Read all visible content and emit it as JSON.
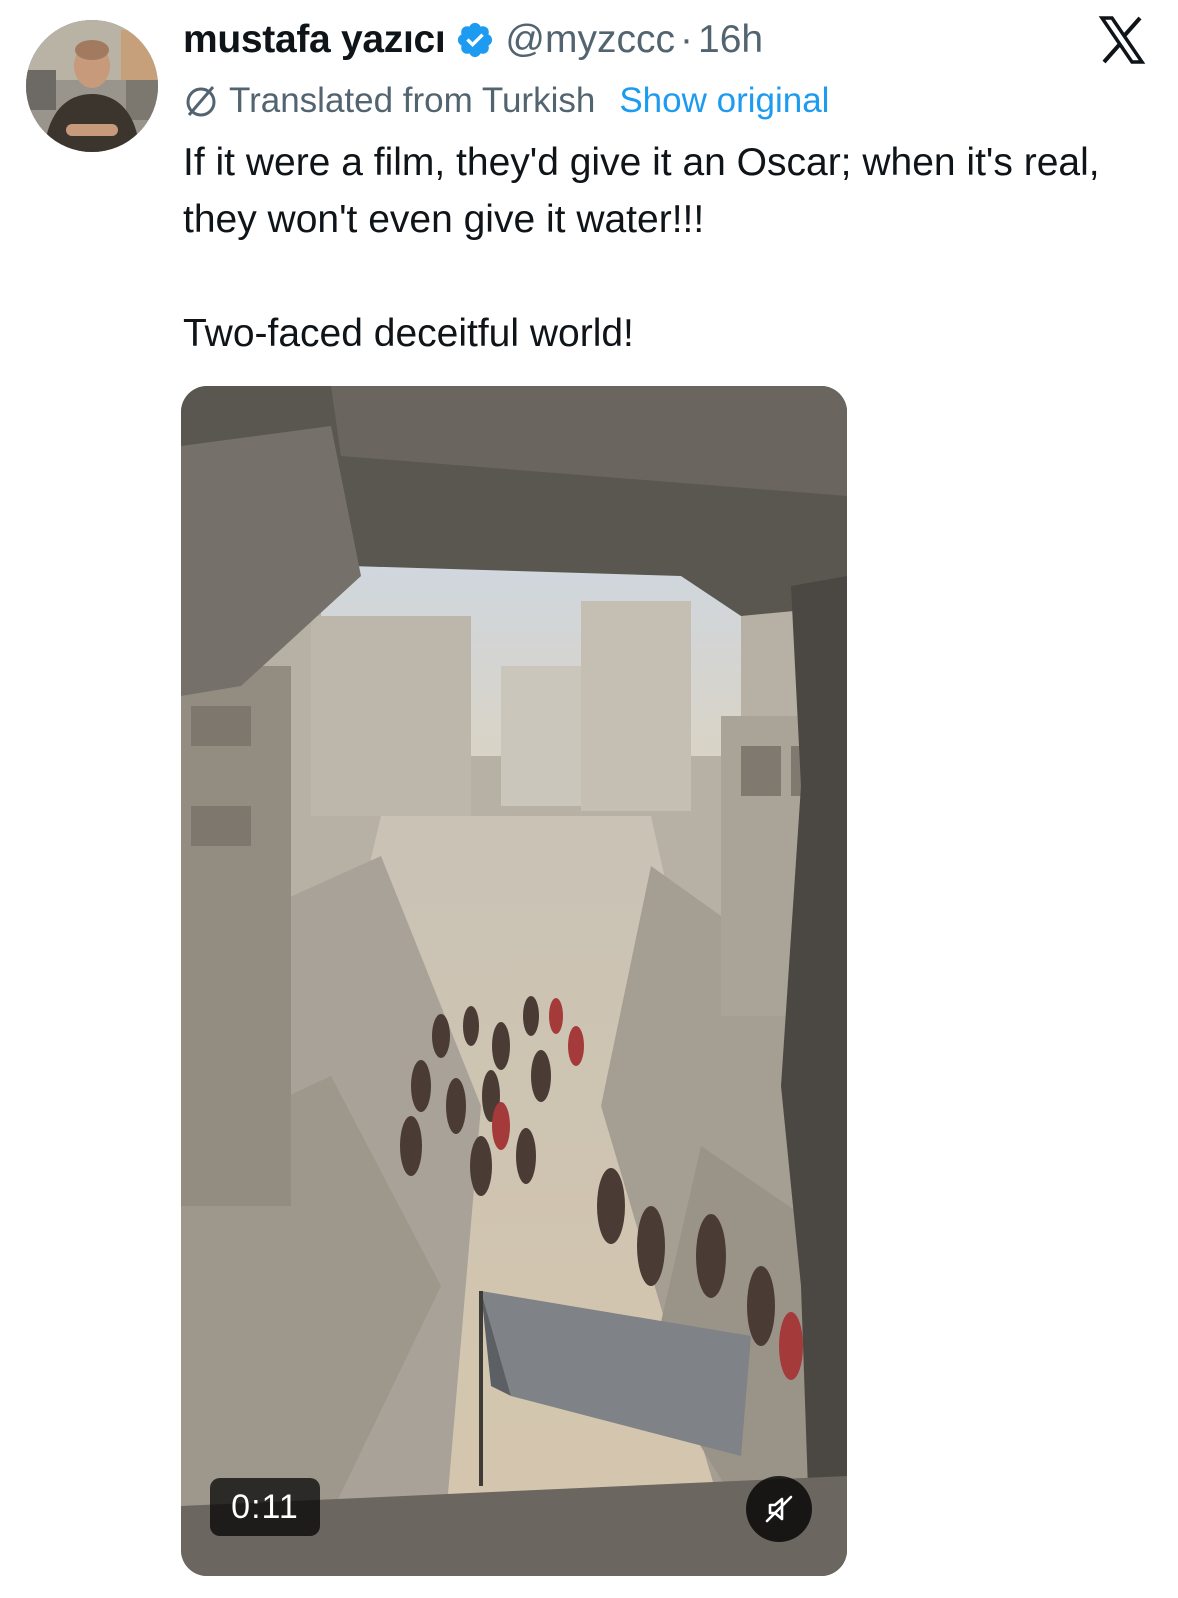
{
  "author": {
    "display_name": "mustafa yazıcı",
    "handle": "@myzccc",
    "separator": "·",
    "time": "16h",
    "verified": true,
    "verified_color": "#1d9bf0"
  },
  "translation": {
    "label": "Translated from Turkish",
    "action": "Show original",
    "link_color": "#1d9bf0"
  },
  "tweet": {
    "text_line1": "If it were a film, they'd give it an Oscar; when it's real, they won't even give it water!!!",
    "text_line2": "Two-faced deceitful world!"
  },
  "media": {
    "duration": "0:11",
    "muted": true
  },
  "icons": {
    "brand": "x-logo-icon",
    "verified": "verified-badge-icon",
    "translate": "globe-icon",
    "mute": "speaker-muted-icon"
  }
}
